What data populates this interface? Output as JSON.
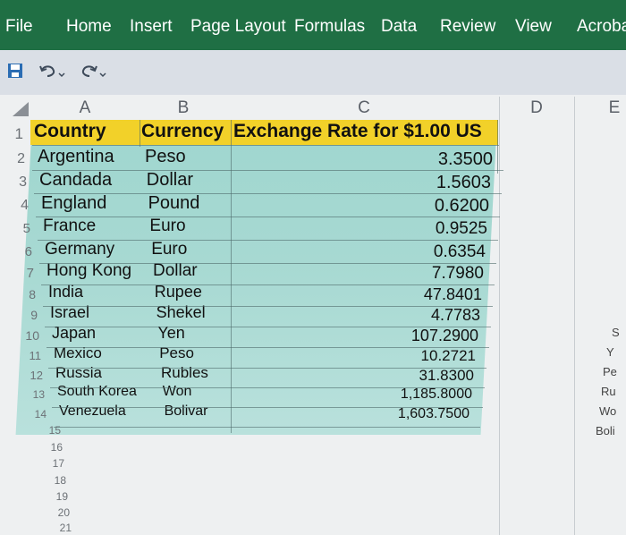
{
  "ribbon": {
    "tabs": [
      "File",
      "Home",
      "Insert",
      "Page Layout",
      "Formulas",
      "Data",
      "Review",
      "View",
      "Acroba"
    ]
  },
  "sheet": {
    "columns": [
      "A",
      "B",
      "C",
      "D",
      "E"
    ],
    "header": {
      "country": "Country",
      "currency": "Currency",
      "rate": "Exchange Rate for $1.00 US"
    },
    "rows": [
      {
        "n": "2",
        "country": "Argentina",
        "currency": "Peso",
        "rate": "3.3500"
      },
      {
        "n": "3",
        "country": "Candada",
        "currency": "Dollar",
        "rate": "1.5603"
      },
      {
        "n": "4",
        "country": "England",
        "currency": "Pound",
        "rate": "0.6200"
      },
      {
        "n": "5",
        "country": "France",
        "currency": "Euro",
        "rate": "0.9525"
      },
      {
        "n": "6",
        "country": "Germany",
        "currency": "Euro",
        "rate": "0.6354"
      },
      {
        "n": "7",
        "country": "Hong Kong",
        "currency": "Dollar",
        "rate": "7.7980"
      },
      {
        "n": "8",
        "country": "India",
        "currency": "Rupee",
        "rate": "47.8401"
      },
      {
        "n": "9",
        "country": "Israel",
        "currency": "Shekel",
        "rate": "4.7783"
      },
      {
        "n": "10",
        "country": "Japan",
        "currency": "Yen",
        "rate": "107.2900"
      },
      {
        "n": "11",
        "country": "Mexico",
        "currency": "Peso",
        "rate": "10.2721"
      },
      {
        "n": "12",
        "country": "Russia",
        "currency": "Rubles",
        "rate": "31.8300"
      },
      {
        "n": "13",
        "country": "South Korea",
        "currency": "Won",
        "rate": "1,185.8000"
      },
      {
        "n": "14",
        "country": "Venezuela",
        "currency": "Bolivar",
        "rate": "1,603.7500"
      }
    ],
    "empty_rows": [
      "15",
      "16",
      "17",
      "18",
      "19",
      "20",
      "21"
    ],
    "right_fragments": [
      "S",
      "Y",
      "Pe",
      "Ru",
      "Wo",
      "Boli"
    ]
  }
}
